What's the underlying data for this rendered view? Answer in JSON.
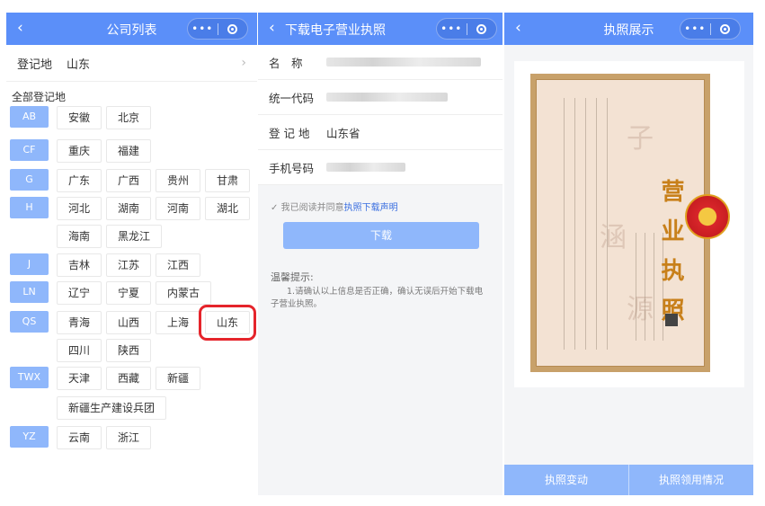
{
  "panel1": {
    "title": "公司列表",
    "region_label": "登记地",
    "region_value": "山东",
    "all_label": "全部登记地",
    "groups": [
      {
        "tag": "AB",
        "items": [
          "安徽",
          "北京"
        ]
      },
      {
        "tag": "CF",
        "items": [
          "重庆",
          "福建"
        ]
      },
      {
        "tag": "G",
        "items": [
          "广东",
          "广西",
          "贵州",
          "甘肃"
        ]
      },
      {
        "tag": "H",
        "items": [
          "河北",
          "湖南",
          "河南",
          "湖北"
        ]
      },
      {
        "tag": "",
        "items": [
          "海南",
          "黑龙江"
        ]
      },
      {
        "tag": "J",
        "items": [
          "吉林",
          "江苏",
          "江西"
        ]
      },
      {
        "tag": "LN",
        "items": [
          "辽宁",
          "宁夏",
          "内蒙古"
        ]
      },
      {
        "tag": "QS",
        "items": [
          "青海",
          "山西",
          "上海",
          "山东"
        ]
      },
      {
        "tag": "",
        "items": [
          "四川",
          "陕西"
        ]
      },
      {
        "tag": "TWX",
        "items": [
          "天津",
          "西藏",
          "新疆"
        ]
      },
      {
        "tag": "",
        "items": [
          "新疆生产建设兵团"
        ]
      },
      {
        "tag": "YZ",
        "items": [
          "云南",
          "浙江"
        ]
      }
    ],
    "selected": "山东"
  },
  "panel2": {
    "title": "下载电子营业执照",
    "fields": [
      {
        "label": "名　称",
        "value": ""
      },
      {
        "label": "统一代码",
        "value": ""
      },
      {
        "label": "登 记 地",
        "value": "山东省"
      },
      {
        "label": "手机号码",
        "value": ""
      }
    ],
    "agree_prefix": "我已阅读并同意",
    "agree_link": "执照下载声明",
    "download_label": "下载",
    "tip_title": "温馨提示:",
    "tip_text": "1.请确认以上信息是否正确，确认无误后开始下载电子营业执照。"
  },
  "panel3": {
    "title": "执照展示",
    "cert_title": "营业执照",
    "btn_change": "执照变动",
    "btn_usage": "执照领用情况"
  },
  "icons": {
    "back": "‹",
    "more": "•••",
    "arrow": "›",
    "check": "✓"
  },
  "colors": {
    "accent": "#5b8ff9",
    "light_accent": "#8fb7fb",
    "highlight": "#e5242b"
  }
}
